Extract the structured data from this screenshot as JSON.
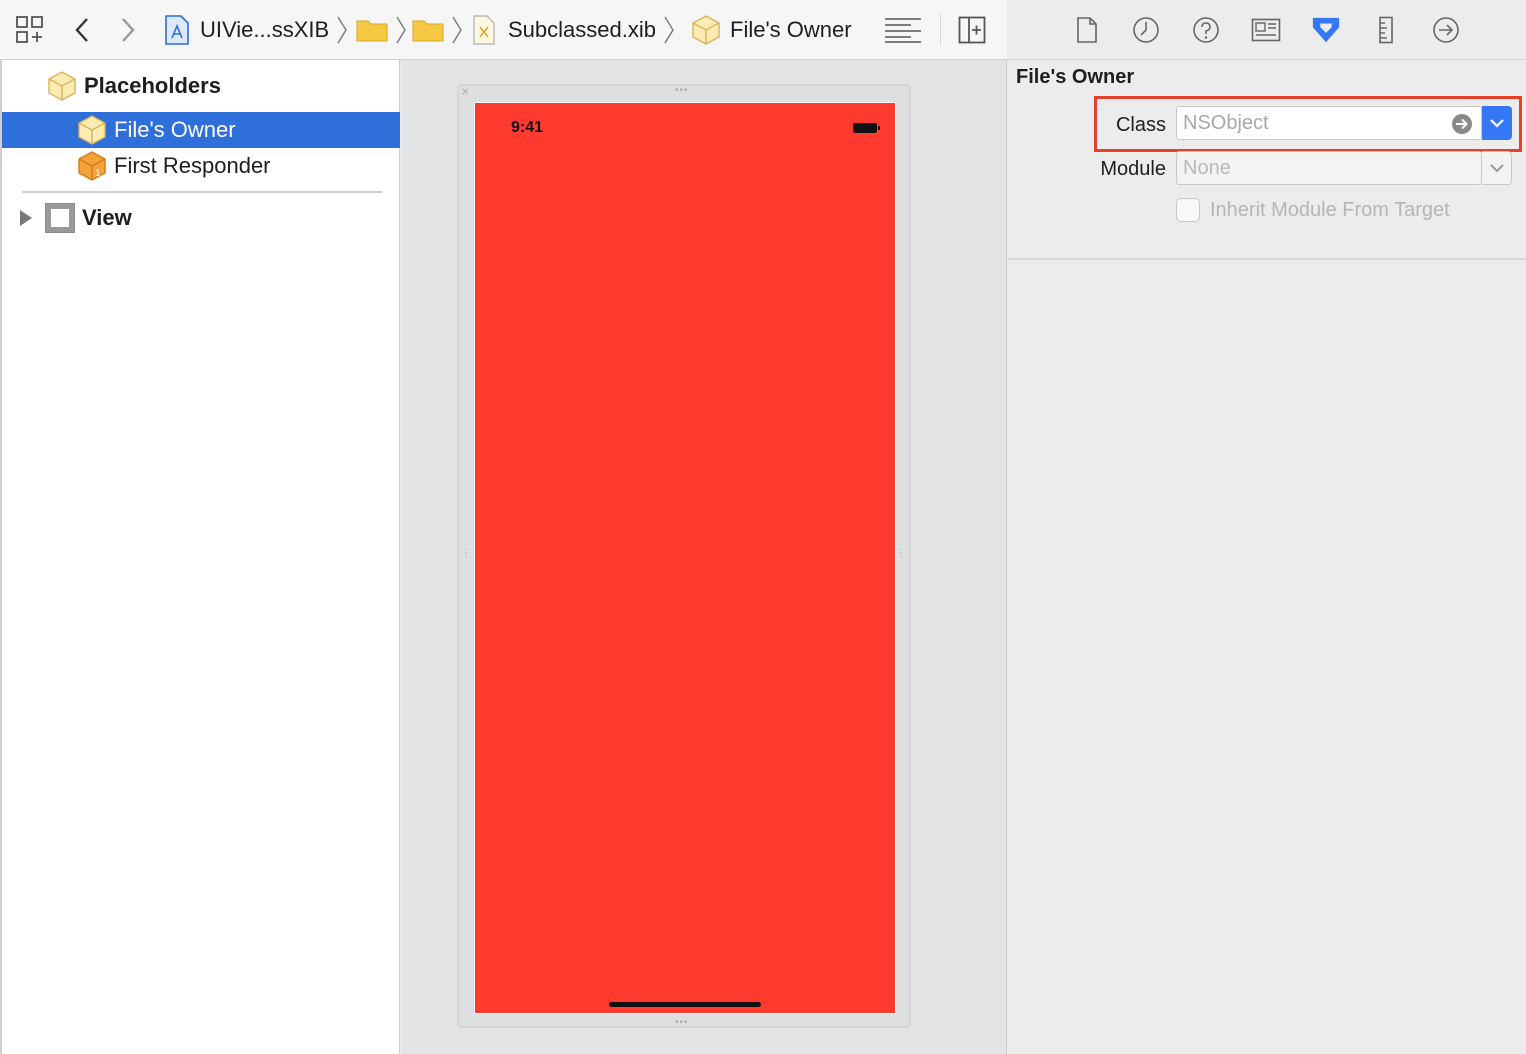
{
  "jumpbar": {
    "related_items_icon": "grid-related-icon",
    "back_icon": "chevron-left-icon",
    "forward_icon": "chevron-right-icon",
    "breadcrumbs": [
      {
        "icon": "project-icon",
        "label": "UIVie...ssXIB"
      },
      {
        "icon": "folder-icon",
        "label": ""
      },
      {
        "icon": "folder-icon",
        "label": ""
      },
      {
        "icon": "xib-file-icon",
        "label": "Subclassed.xib"
      },
      {
        "icon": "cube-icon",
        "label": "File's Owner"
      }
    ],
    "editor_options_icon": "lines-icon",
    "add_editor_icon": "add-editor-icon"
  },
  "outline": {
    "placeholders_label": "Placeholders",
    "files_owner_label": "File's Owner",
    "first_responder_label": "First Responder",
    "view_label": "View"
  },
  "canvas": {
    "status_time": "9:41",
    "screen_color": "#ff3b30"
  },
  "inspector": {
    "tabs": [
      "file-icon",
      "history-icon",
      "help-icon",
      "identity-card-icon",
      "identity-inspector-icon",
      "ruler-icon",
      "connections-icon"
    ],
    "active_tab": "identity-inspector-icon",
    "section_title": "File's Owner",
    "class_label": "Class",
    "class_placeholder": "NSObject",
    "module_label": "Module",
    "module_placeholder": "None",
    "inherit_label": "Inherit Module From Target",
    "inherit_checked": false
  },
  "colors": {
    "selection": "#2e6fd9",
    "accent": "#3478f6",
    "highlight_box": "#e8402a"
  }
}
